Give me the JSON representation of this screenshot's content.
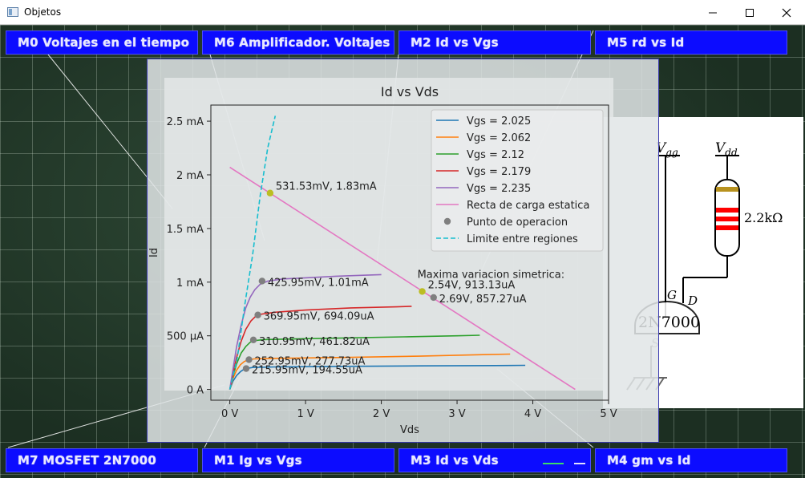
{
  "window": {
    "title": "Objetos"
  },
  "tabs": [
    {
      "label": "M0  Voltajes en el tiempo"
    },
    {
      "label": "M6  Amplificador. Voltajes"
    },
    {
      "label": "M2  Id vs Vgs"
    },
    {
      "label": "M5  rd vs Id"
    },
    {
      "label": "M7  MOSFET 2N7000"
    },
    {
      "label": "M1  Ig vs Vgs"
    },
    {
      "label": "M3  Id vs Vds"
    },
    {
      "label": "M4  gm vs Id"
    }
  ],
  "schematic": {
    "vgg_label": "V",
    "vgg_sub": "gg",
    "vdd_label": "V",
    "vdd_sub": "dd",
    "resistor": "2.2kΩ",
    "gate": "G",
    "drain": "D",
    "source": "S",
    "part": "2N7000"
  },
  "chart_data": {
    "type": "line",
    "title": "Id vs Vds",
    "xlabel": "Vds",
    "ylabel": "Id",
    "xlim": [
      -0.25,
      5.0
    ],
    "ylim": [
      -0.1,
      2.65
    ],
    "x_ticks": [
      0,
      1,
      2,
      3,
      4,
      5
    ],
    "x_tick_labels": [
      "0 V",
      "1 V",
      "2 V",
      "3 V",
      "4 V",
      "5 V"
    ],
    "y_ticks": [
      0,
      0.5,
      1,
      1.5,
      2,
      2.5
    ],
    "y_tick_labels": [
      "0 A",
      "500 µA",
      "1 mA",
      "1.5 mA",
      "2 mA",
      "2.5 mA"
    ],
    "legend_position": "top-right",
    "series": [
      {
        "name": "Vgs = 2.025",
        "color": "#1f77b4",
        "x": [
          0,
          0.04,
          0.09,
          0.14,
          0.18,
          0.22,
          0.3,
          0.6,
          1.5,
          2.5,
          3.5,
          3.9
        ],
        "y": [
          0,
          0.075,
          0.13,
          0.165,
          0.185,
          0.195,
          0.205,
          0.21,
          0.215,
          0.22,
          0.223,
          0.225
        ]
      },
      {
        "name": "Vgs = 2.062",
        "color": "#ff7f0e",
        "x": [
          0,
          0.04,
          0.09,
          0.14,
          0.19,
          0.24,
          0.32,
          0.6,
          1.5,
          2.5,
          3.4,
          3.7
        ],
        "y": [
          0,
          0.1,
          0.18,
          0.23,
          0.26,
          0.275,
          0.285,
          0.29,
          0.298,
          0.31,
          0.325,
          0.33
        ]
      },
      {
        "name": "Vgs = 2.12",
        "color": "#2ca02c",
        "x": [
          0,
          0.04,
          0.09,
          0.15,
          0.21,
          0.27,
          0.33,
          0.45,
          0.8,
          1.5,
          2.3,
          3.0,
          3.3
        ],
        "y": [
          0,
          0.12,
          0.24,
          0.34,
          0.4,
          0.44,
          0.455,
          0.465,
          0.47,
          0.48,
          0.49,
          0.5,
          0.505
        ]
      },
      {
        "name": "Vgs = 2.179",
        "color": "#d62728",
        "x": [
          0,
          0.04,
          0.09,
          0.15,
          0.21,
          0.28,
          0.34,
          0.4,
          0.6,
          1.0,
          1.6,
          2.2,
          2.4
        ],
        "y": [
          0,
          0.14,
          0.3,
          0.45,
          0.56,
          0.64,
          0.68,
          0.7,
          0.72,
          0.74,
          0.76,
          0.77,
          0.775
        ]
      },
      {
        "name": "Vgs = 2.235",
        "color": "#9467bd",
        "x": [
          0,
          0.04,
          0.09,
          0.15,
          0.21,
          0.27,
          0.33,
          0.4,
          0.5,
          0.7,
          1.0,
          1.4,
          1.8,
          2.0
        ],
        "y": [
          0,
          0.18,
          0.4,
          0.6,
          0.76,
          0.86,
          0.93,
          0.98,
          1.01,
          1.03,
          1.04,
          1.055,
          1.065,
          1.07
        ]
      },
      {
        "name": "Recta de carga estatica",
        "color": "#e377c2",
        "x": [
          0,
          4.56
        ],
        "y": [
          2.07,
          0
        ]
      },
      {
        "name": "Limite entre regiones",
        "color": "#17becf",
        "dashed": true,
        "x": [
          0,
          0.1,
          0.2,
          0.3,
          0.4,
          0.5,
          0.6
        ],
        "y": [
          0,
          0.3,
          0.8,
          1.25,
          1.8,
          2.25,
          2.55
        ]
      }
    ],
    "operating_points": {
      "name": "Punto de operacion",
      "color": "#7f7f7f",
      "points": [
        {
          "x": 0.216,
          "y": 0.195,
          "label": "215.95mV, 194.55uA"
        },
        {
          "x": 0.253,
          "y": 0.278,
          "label": "252.95mV, 277.73uA"
        },
        {
          "x": 0.311,
          "y": 0.462,
          "label": "310.95mV, 461.82uA"
        },
        {
          "x": 0.37,
          "y": 0.694,
          "label": "369.95mV, 694.09uA"
        },
        {
          "x": 0.426,
          "y": 1.01,
          "label": "425.95mV, 1.01mA"
        },
        {
          "x": 2.69,
          "y": 0.857,
          "label": "2.69V, 857.27uA"
        }
      ]
    },
    "highlight_points": [
      {
        "x": 0.532,
        "y": 1.83,
        "label": "531.53mV, 1.83mA",
        "color": "#bcbd22"
      },
      {
        "x": 2.54,
        "y": 0.913,
        "label": "2.54V, 913.13uA",
        "color": "#bcbd22"
      }
    ],
    "annotation": "Maxima variacion simetrica:"
  }
}
